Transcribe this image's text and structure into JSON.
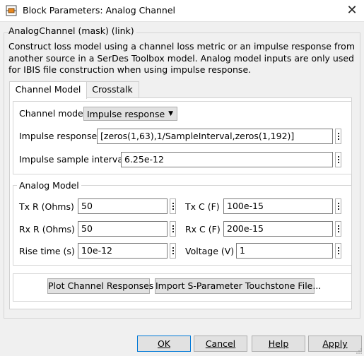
{
  "window": {
    "title": "Block Parameters: Analog Channel"
  },
  "mask": {
    "label": "AnalogChannel (mask) (link)",
    "description": "Construct loss model using a channel loss metric or an impulse response from another source in a SerDes Toolbox model.  Analog model inputs are only used for IBIS file construction when using impulse response."
  },
  "tabs": [
    {
      "label": "Channel Model",
      "active": true
    },
    {
      "label": "Crosstalk",
      "active": false
    }
  ],
  "channel": {
    "model_label": "Channel model",
    "model_value": "Impulse response",
    "impulse_label": "Impulse response",
    "impulse_value": "[zeros(1,63),1/SampleInterval,zeros(1,192)]",
    "interval_label": "Impulse sample interval",
    "interval_value": "6.25e-12"
  },
  "analog": {
    "title": "Analog Model",
    "txr_label": "Tx R (Ohms)",
    "txr_value": "50",
    "txc_label": "Tx C (F)",
    "txc_value": "100e-15",
    "rxr_label": "Rx R (Ohms)",
    "rxr_value": "50",
    "rxc_label": "Rx C (F)",
    "rxc_value": "200e-15",
    "rise_label": "Rise time (s)",
    "rise_value": "10e-12",
    "volt_label": "Voltage (V)",
    "volt_value": "1"
  },
  "actions": {
    "plot": "Plot Channel Responses",
    "import": "Import S-Parameter Touchstone File..."
  },
  "buttons": {
    "ok": "OK",
    "cancel": "Cancel",
    "help": "Help",
    "apply": "Apply"
  },
  "colors": {
    "accent": "#0078d7",
    "icon_orange": "#e8871e"
  }
}
